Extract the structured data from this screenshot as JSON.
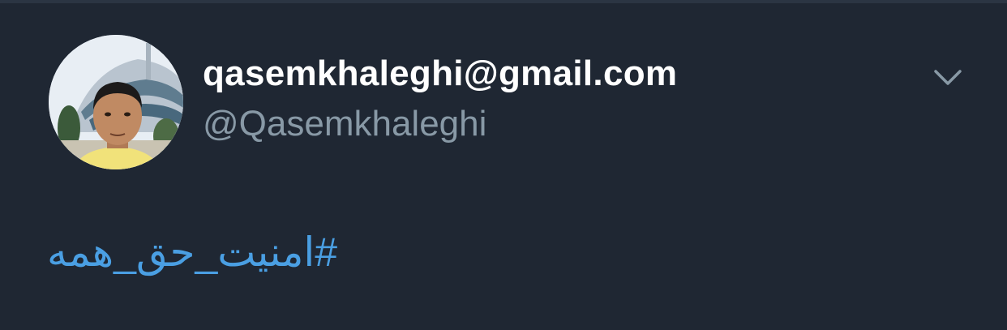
{
  "tweet": {
    "display_name": "qasemkhaleghi@gmail.com",
    "handle": "@Qasemkhaleghi",
    "hashtag": "#امنیت_حق_همه"
  },
  "icons": {
    "avatar": "profile-photo",
    "menu": "chevron-down-icon"
  },
  "colors": {
    "background": "#1f2733",
    "name": "#ffffff",
    "handle": "#8899a6",
    "link": "#4a9fe3"
  }
}
